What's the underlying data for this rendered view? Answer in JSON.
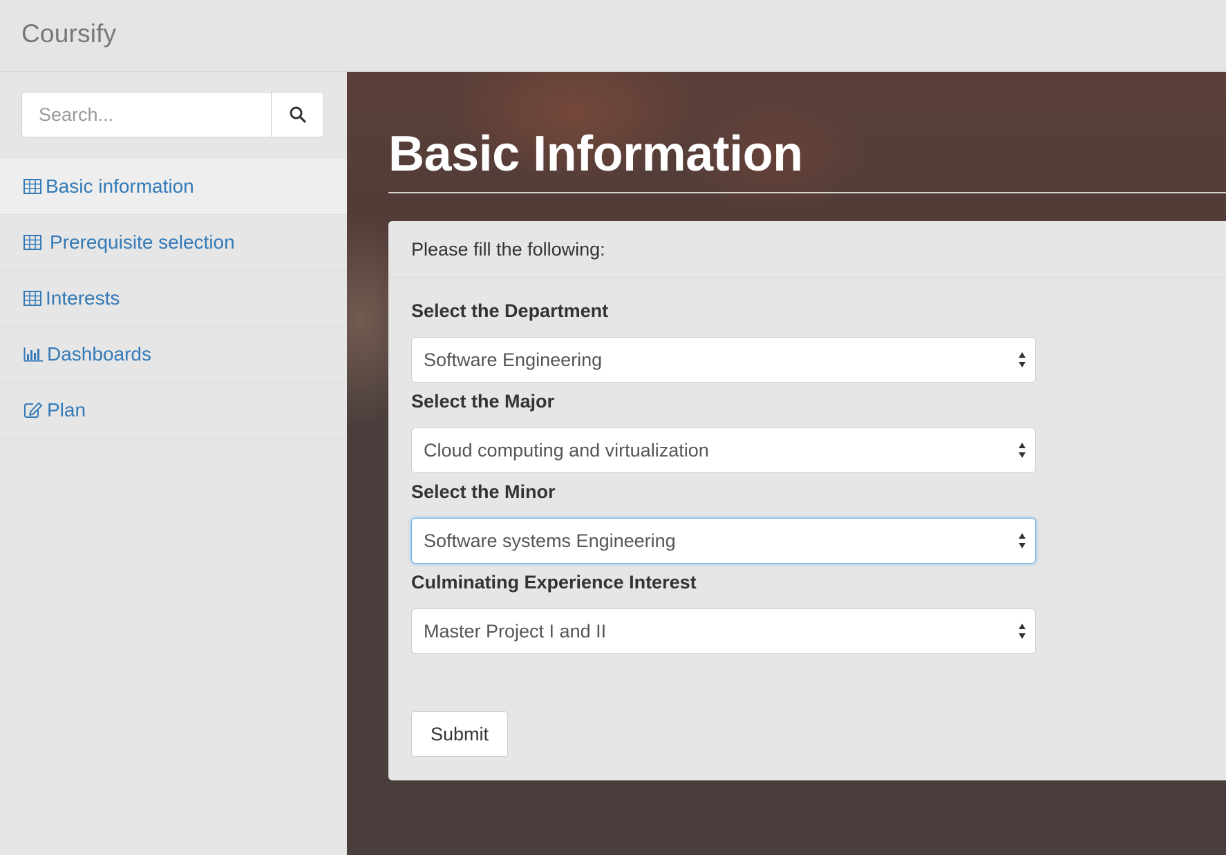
{
  "app": {
    "brand": "Coursify"
  },
  "search": {
    "placeholder": "Search..."
  },
  "sidebar": {
    "items": [
      {
        "label": "Basic information",
        "icon": "table-icon",
        "active": true
      },
      {
        "label": "Prerequisite selection",
        "icon": "table-icon",
        "active": false
      },
      {
        "label": "Interests",
        "icon": "table-icon",
        "active": false
      },
      {
        "label": "Dashboards",
        "icon": "bar-chart-icon",
        "active": false
      },
      {
        "label": "Plan",
        "icon": "edit-icon",
        "active": false
      }
    ]
  },
  "main": {
    "title": "Basic Information",
    "panel_heading": "Please fill the following:",
    "fields": [
      {
        "label": "Select the Department",
        "value": "Software Engineering"
      },
      {
        "label": "Select the Major",
        "value": "Cloud computing and virtualization"
      },
      {
        "label": "Select the Minor",
        "value": "Software systems Engineering"
      },
      {
        "label": "Culminating Experience Interest",
        "value": "Master Project I and II"
      }
    ],
    "submit_label": "Submit"
  },
  "colors": {
    "link": "#337ab7",
    "focus": "#66afe9",
    "header_bg": "#4a3e3d"
  }
}
